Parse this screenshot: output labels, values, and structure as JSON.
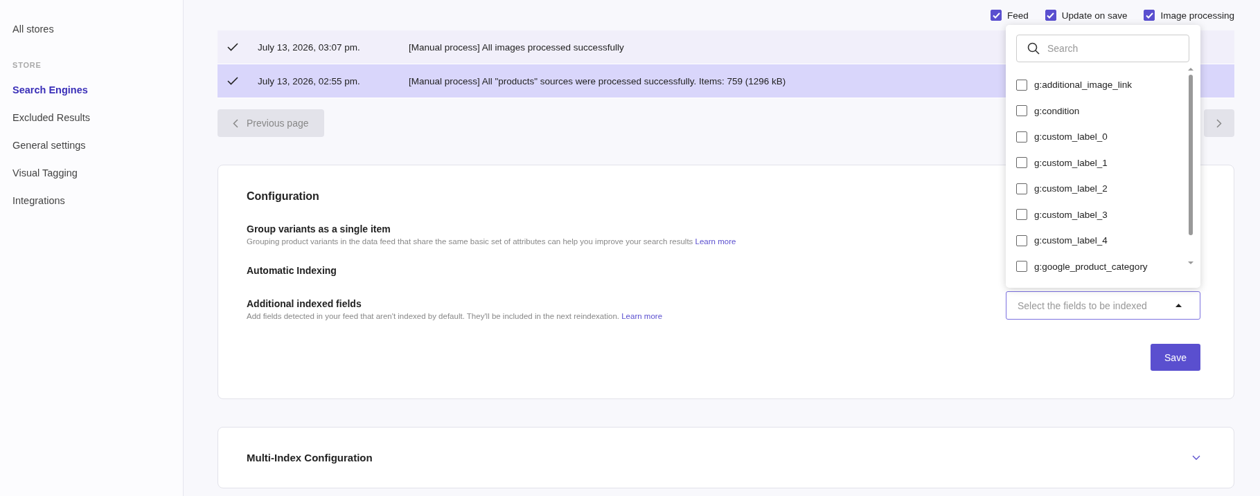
{
  "sidebar": {
    "top_link": "All stores",
    "section": "STORE",
    "items": [
      {
        "label": "Search Engines",
        "selected": true
      },
      {
        "label": "Excluded Results",
        "selected": false
      },
      {
        "label": "General settings",
        "selected": false
      },
      {
        "label": "Visual Tagging",
        "selected": false
      },
      {
        "label": "Integrations",
        "selected": false
      }
    ]
  },
  "toggles": [
    {
      "label": "Feed",
      "checked": true
    },
    {
      "label": "Update on save",
      "checked": true
    },
    {
      "label": "Image processing",
      "checked": true
    }
  ],
  "log_rows": [
    {
      "date": "July 13, 2026, 03:07 pm.",
      "message": "[Manual process] All images processed successfully",
      "selected": false
    },
    {
      "date": "July 13, 2026, 02:55 pm.",
      "message": "[Manual process] All \"products\" sources were processed successfully. Items: 759 (1296 kB)",
      "selected": true
    }
  ],
  "pagination": {
    "previous": {
      "label": "Previous page",
      "disabled": true
    },
    "next": {
      "disabled": true
    }
  },
  "configuration": {
    "title": "Configuration",
    "settings": [
      {
        "title": "Group variants as a single item",
        "description": "Grouping product variants in the data feed that share the same basic set of attributes can help you improve your search results",
        "link": "Learn more"
      },
      {
        "title": "Automatic Indexing"
      },
      {
        "title": "Additional indexed fields",
        "description": "Add fields detected in your feed that aren't indexed by default. They'll be included in the next reindexation.",
        "link": "Learn more"
      }
    ],
    "select": {
      "placeholder": "Select the fields to be indexed",
      "expanded": true
    },
    "dropdown": {
      "search_placeholder": "Search",
      "options": [
        {
          "label": "g:additional_image_link",
          "checked": false
        },
        {
          "label": "g:condition",
          "checked": false
        },
        {
          "label": "g:custom_label_0",
          "checked": false
        },
        {
          "label": "g:custom_label_1",
          "checked": false
        },
        {
          "label": "g:custom_label_2",
          "checked": false
        },
        {
          "label": "g:custom_label_3",
          "checked": false
        },
        {
          "label": "g:custom_label_4",
          "checked": false
        },
        {
          "label": "g:google_product_category",
          "checked": false
        }
      ]
    },
    "save": "Save"
  },
  "multi_index": {
    "title": "Multi-Index Configuration",
    "expanded": false
  }
}
